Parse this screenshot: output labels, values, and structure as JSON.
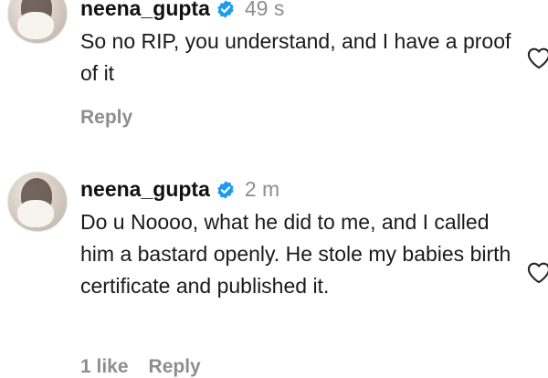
{
  "comments": [
    {
      "username": "neena_gupta",
      "time": "49 s",
      "text": "So no RIP, you understand, and I have a proof of it",
      "reply_label": "Reply"
    },
    {
      "username": "neena_gupta",
      "time": "2 m",
      "text": "Do u Noooo, what he did to me, and I called him a bastard openly. He stole my babies birth certificate and published it.",
      "likes_label": "1 like",
      "reply_label": "Reply"
    }
  ],
  "icons": {
    "verified": "verified-badge-icon",
    "like": "heart-outline-icon"
  },
  "colors": {
    "verified": "#1d9bf0",
    "meta": "#8e8e8e",
    "text": "#1a1a1a"
  }
}
